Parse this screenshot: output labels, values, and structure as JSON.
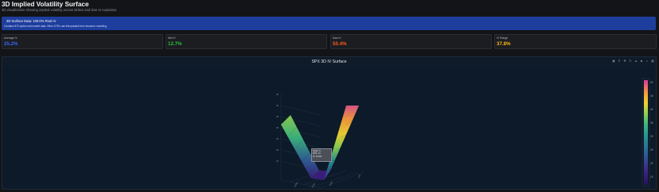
{
  "page": {
    "title": "3D Implied Volatility Surface",
    "subtitle": "3D visualization showing implied volatility across strikes and time to expiration."
  },
  "banner": {
    "title": "3D Surface Data: 100.0% Real IV",
    "text": "Contains 870 option real market data. Other DTEs use interpolated term structure modeling."
  },
  "metrics": [
    {
      "label": "Average IV",
      "value": "25.2%",
      "color": "#3b63ff"
    },
    {
      "label": "Min IV",
      "value": "12.7%",
      "color": "#29c23a"
    },
    {
      "label": "Max IV",
      "value": "50.4%",
      "color": "#ff5a1f"
    },
    {
      "label": "IV Range",
      "value": "37.8%",
      "color": "#ffb21a"
    }
  ],
  "chart": {
    "title": "SPX 3D IV Surface",
    "modebar_icons": [
      "camera-icon",
      "zoom-icon",
      "pan-icon",
      "orbit-icon",
      "turntable-icon",
      "reset-camera-icon",
      "home-icon",
      "plotly-logo-icon"
    ],
    "tooltip": {
      "line1": "Strike: 5...",
      "line2": "DTE: 14",
      "line3": "IV: 12.8%"
    }
  },
  "chart_data": {
    "type": "surface",
    "title": "SPX 3D IV Surface",
    "colorbar": {
      "min": 12.7,
      "max": 50.4,
      "ticks": [
        15,
        20,
        25,
        30,
        35,
        40,
        45,
        50
      ]
    },
    "z_axis_ticks": [
      15,
      20,
      25,
      30,
      35,
      40,
      45
    ],
    "colorscale": [
      "#2b0f5a",
      "#3b2b8c",
      "#2f5f96",
      "#22918f",
      "#3cb77d",
      "#8fd14f",
      "#f2d132",
      "#f59a3c",
      "#ea5f78",
      "#cf3e8f"
    ],
    "surface_shape": "volatility-smile",
    "min_iv": 12.7,
    "max_iv": 50.4,
    "avg_iv": 25.2
  }
}
